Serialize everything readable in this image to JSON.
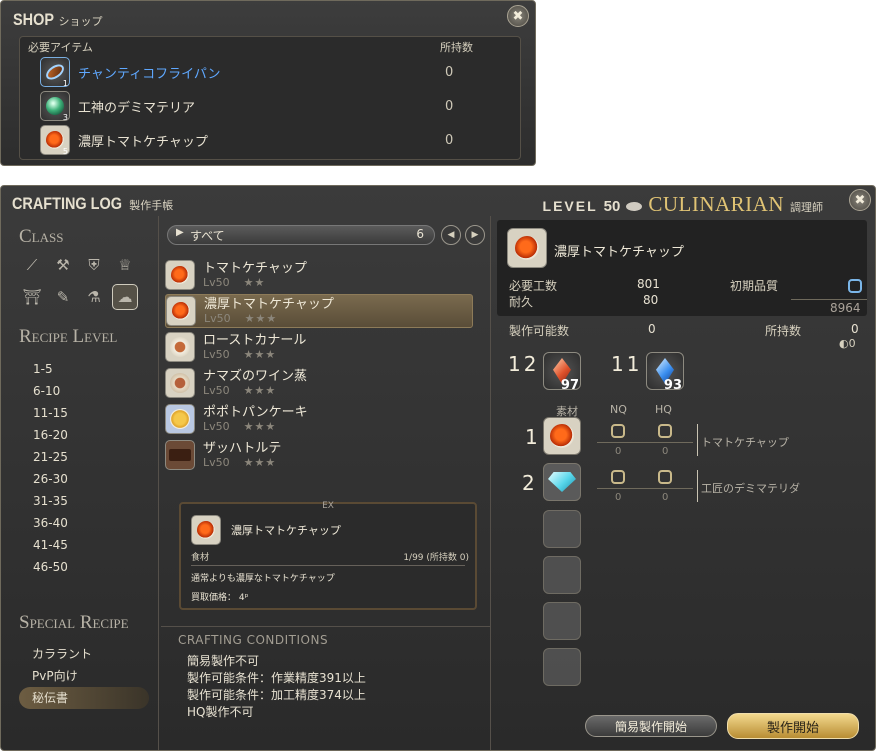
{
  "shop": {
    "title": "SHOP",
    "title_jp": "ショップ",
    "close_glyph": "✖",
    "column_item": "必要アイテム",
    "column_owned": "所持数",
    "items": [
      {
        "name": "チャンティコフライパン",
        "count": "0",
        "sub": "1",
        "icon": "frying-pan-icon"
      },
      {
        "name": "工神のデミマテリア",
        "count": "0",
        "sub": "3",
        "icon": "materia-icon"
      },
      {
        "name": "濃厚トマトケチャップ",
        "count": "0",
        "sub": "5",
        "icon": "ketchup-icon"
      }
    ]
  },
  "log": {
    "title": "CRAFTING LOG",
    "title_jp": "製作手帳",
    "level_label": "LEVEL",
    "level": "50",
    "class_name": "CULINARIAN",
    "class_jp": "調理師",
    "close_glyph": "✖",
    "sections": {
      "class": "Class",
      "recipe_level": "Recipe Level",
      "special_recipe": "Special Recipe"
    },
    "class_icons": [
      "carpenter-icon",
      "blacksmith-icon",
      "armorer-icon",
      "goldsmith-icon",
      "leatherworker-icon",
      "weaver-icon",
      "alchemist-icon",
      "culinarian-icon"
    ],
    "recipe_levels": [
      "1-5",
      "6-10",
      "11-15",
      "16-20",
      "21-25",
      "26-30",
      "31-35",
      "36-40",
      "41-45",
      "46-50"
    ],
    "special_recipes": [
      "カララント",
      "PvP向け",
      "秘伝書"
    ],
    "selected_special": "秘伝書",
    "filter": {
      "label": "すべて",
      "count": "6",
      "arrow": "▶"
    },
    "nav": {
      "prev": "◀",
      "next": "▶"
    },
    "recipes": [
      {
        "name": "トマトケチャップ",
        "level": "Lv50",
        "stars": "★★",
        "icon": "tomato-ketchup-icon"
      },
      {
        "name": "濃厚トマトケチャップ",
        "level": "Lv50",
        "stars": "★★★",
        "icon": "rich-ketchup-icon"
      },
      {
        "name": "ローストカナール",
        "level": "Lv50",
        "stars": "★★★",
        "icon": "roast-canard-icon"
      },
      {
        "name": "ナマズのワイン蒸",
        "level": "Lv50",
        "stars": "★★★",
        "icon": "steamed-catfish-icon"
      },
      {
        "name": "ポポトパンケーキ",
        "level": "Lv50",
        "stars": "★★★",
        "icon": "pancake-icon"
      },
      {
        "name": "ザッハトルテ",
        "level": "Lv50",
        "stars": "★★★",
        "icon": "sachertorte-icon"
      }
    ],
    "tooltip": {
      "tag": "EX",
      "name": "濃厚トマトケチャップ",
      "category": "食材",
      "stack": "1/99 (所持数 0)",
      "description": "通常よりも濃厚なトマトケチャップ",
      "price": "買取価格： 4ᵖ"
    },
    "conditions": {
      "title": "CRAFTING CONDITIONS",
      "lines": [
        "簡易製作不可",
        "製作可能条件：作業精度391以上",
        "製作可能条件：加工精度374以上",
        "HQ製作不可"
      ]
    },
    "detail": {
      "name": "濃厚トマトケチャップ",
      "difficulty_label": "必要工数",
      "difficulty": "801",
      "durability_label": "耐久",
      "durability": "80",
      "initial_quality_label": "初期品質",
      "max_quality": "8964",
      "craftable_label": "製作可能数",
      "craftable": "0",
      "owned_label": "所持数",
      "owned": "0",
      "owned_hq": "0",
      "shards": [
        {
          "need": "12",
          "have": "97",
          "type": "fire-crystal-icon"
        },
        {
          "need": "11",
          "have": "93",
          "type": "water-crystal-icon"
        }
      ],
      "col_material": "素材",
      "col_nq": "NQ",
      "col_hq": "HQ",
      "materials": [
        {
          "qty": "1",
          "name": "トマトケチャップ",
          "nq": "0",
          "hq": "0",
          "icon": "tomato-ketchup-icon"
        },
        {
          "qty": "2",
          "name": "工匠のデミマテリダ",
          "nq": "0",
          "hq": "0",
          "icon": "demimateria-icon"
        }
      ]
    },
    "buttons": {
      "quick_synth": "簡易製作開始",
      "synthesize": "製作開始"
    }
  },
  "colors": {
    "panel": "#333333",
    "gold_text": "#e0c374",
    "link_blue": "#5fa8ff",
    "selected_row": "#6d5d42"
  }
}
